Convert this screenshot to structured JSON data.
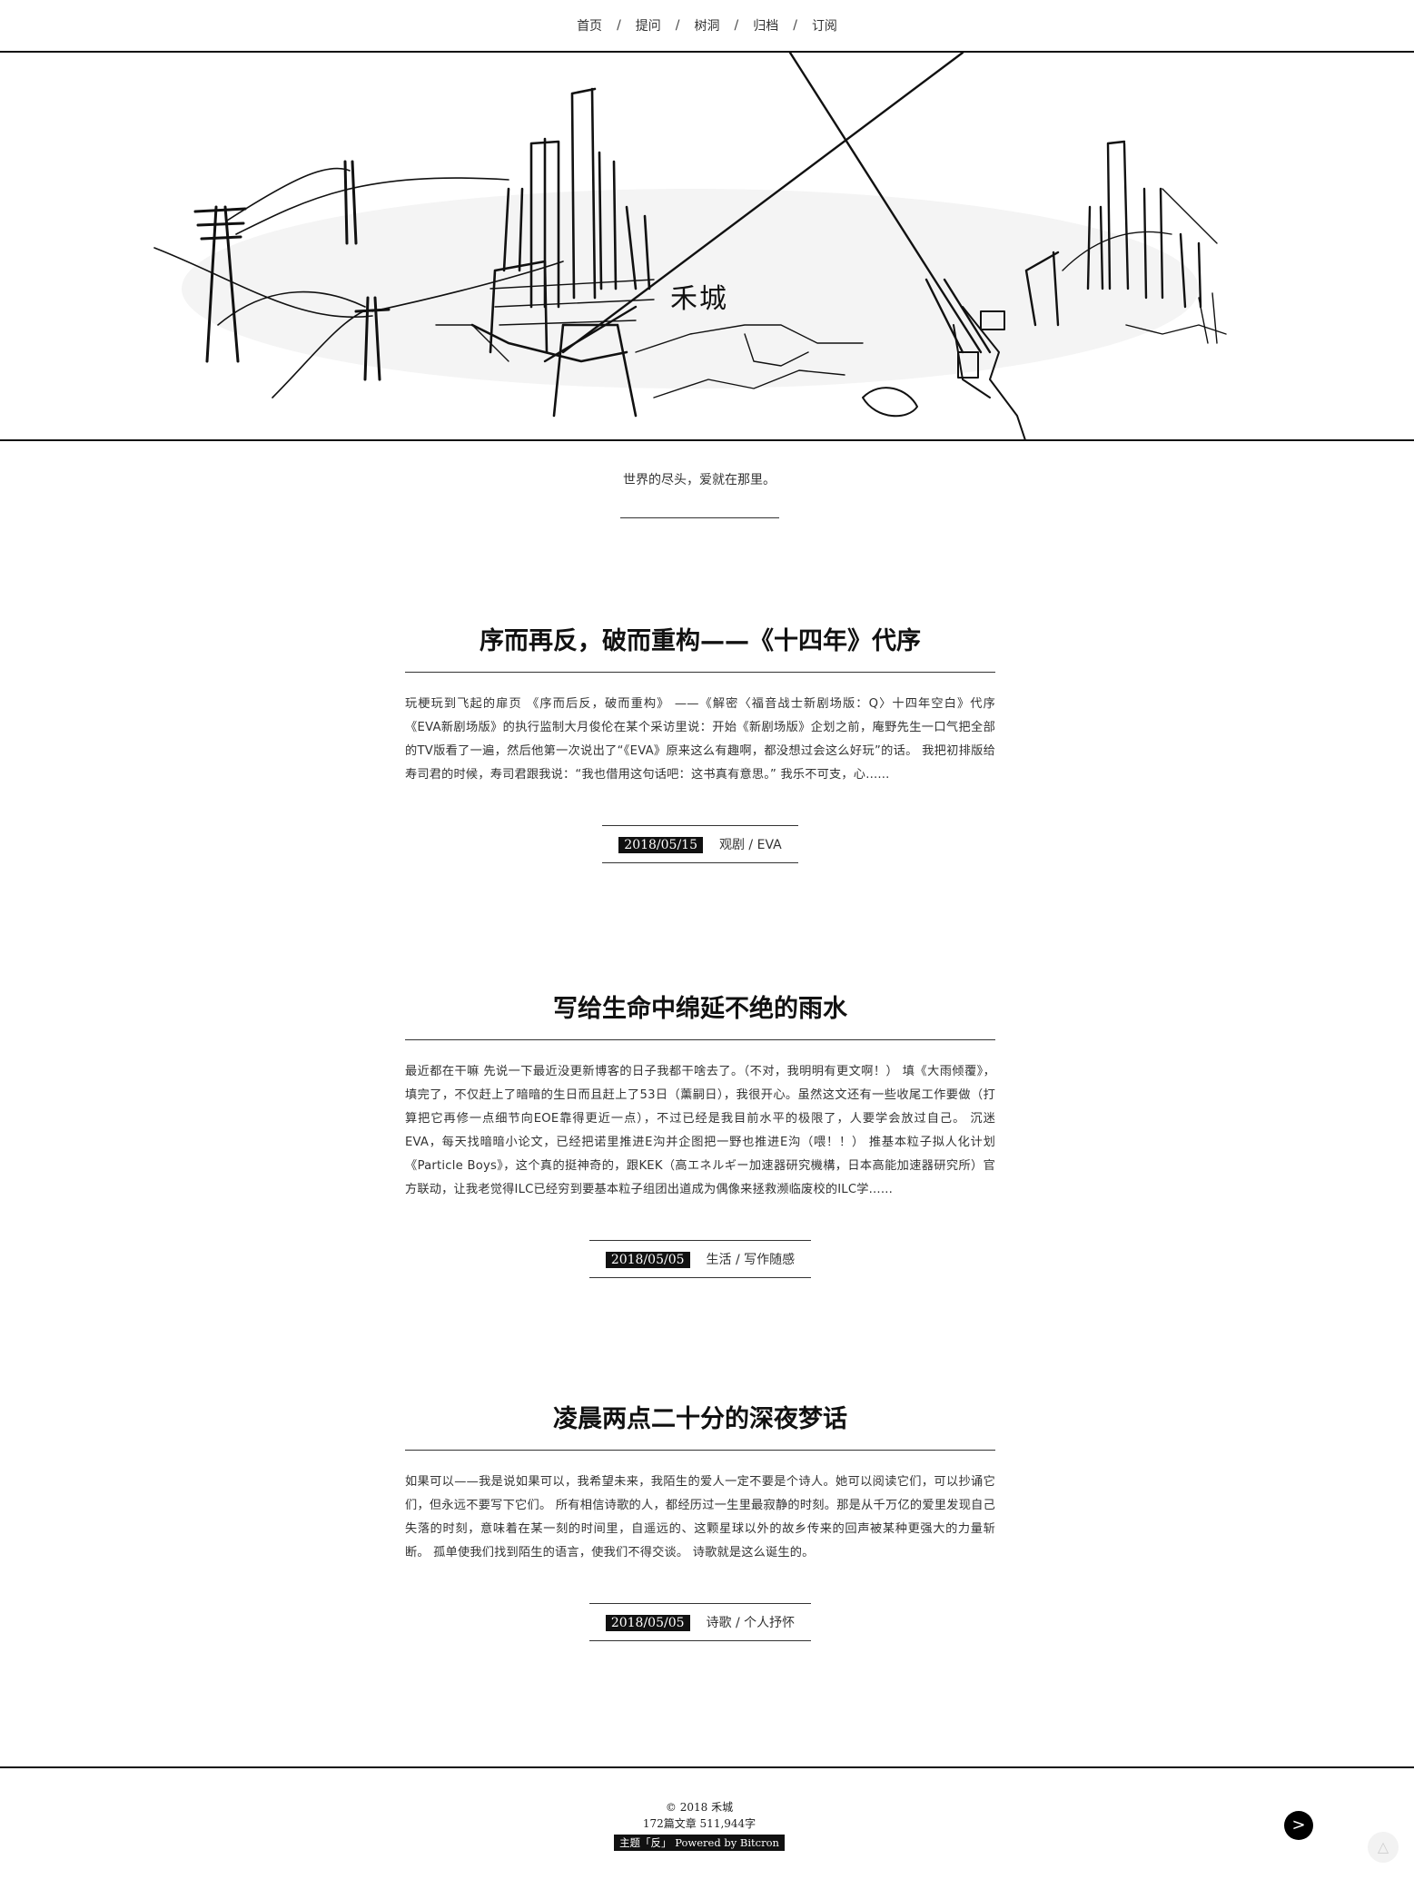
{
  "nav": {
    "items": [
      "首页",
      "提问",
      "树洞",
      "归档",
      "订阅"
    ],
    "separator": "/"
  },
  "site": {
    "title": "禾城",
    "tagline": "世界的尽头，爱就在那里。",
    "hero_image": "pen-and-ink-cityscape-illustration"
  },
  "posts": [
    {
      "title": "序而再反，破而重构——《十四年》代序",
      "excerpt": "玩梗玩到飞起的扉页 《序而后反，破而重构》 ——《解密〈福音战士新剧场版：Q〉十四年空白》代序 《EVA新剧场版》的执行监制大月俊伦在某个采访里说：开始《新剧场版》企划之前，庵野先生一口气把全部的TV版看了一遍，然后他第一次说出了“《EVA》原来这么有趣啊，都没想过会这么好玩”的话。 我把初排版给寿司君的时候，寿司君跟我说：“我也借用这句话吧：这书真有意思。” 我乐不可支，心......",
      "date": "2018/05/15",
      "category": "观剧 / EVA"
    },
    {
      "title": "写给生命中绵延不绝的雨水",
      "excerpt": "最近都在干嘛 先说一下最近没更新博客的日子我都干啥去了。（不对，我明明有更文啊！） 填《大雨倾覆》，填完了，不仅赶上了暗暗的生日而且赶上了53日（薰嗣日），我很开心。虽然这文还有一些收尾工作要做（打算把它再修一点细节向EOE靠得更近一点），不过已经是我目前水平的极限了，人要学会放过自己。 沉迷EVA，每天找暗暗小论文，已经把诺里推进E沟并企图把一野也推进E沟（喂！！） 推基本粒子拟人化计划《Particle Boys》，这个真的挺神奇的，跟KEK（高エネルギー加速器研究機構，日本高能加速器研究所）官方联动，让我老觉得ILC已经穷到要基本粒子组团出道成为偶像来拯救濒临废校的ILC学......",
      "date": "2018/05/05",
      "category": "生活 / 写作随感"
    },
    {
      "title": "凌晨两点二十分的深夜梦话",
      "excerpt": "如果可以——我是说如果可以，我希望未来，我陌生的爱人一定不要是个诗人。她可以阅读它们，可以抄诵它们，但永远不要写下它们。 所有相信诗歌的人，都经历过一生里最寂静的时刻。那是从千万亿的爱里发现自己失落的时刻，意味着在某一刻的时间里，自遥远的、这颗星球以外的故乡传来的回声被某种更强大的力量斩断。 孤单使我们找到陌生的语言，使我们不得交谈。 诗歌就是这么诞生的。",
      "date": "2018/05/05",
      "category": "诗歌 / 个人抒怀"
    }
  ],
  "footer": {
    "copyright": "© 2018 禾城",
    "stats": "172篇文章 511,944字",
    "theme": "主题「反」 Powered by Bitcron"
  },
  "controls": {
    "next_label": ">",
    "top_label": "△"
  },
  "colors": {
    "ink": "#111111",
    "text": "#333333",
    "background": "#ffffff"
  }
}
